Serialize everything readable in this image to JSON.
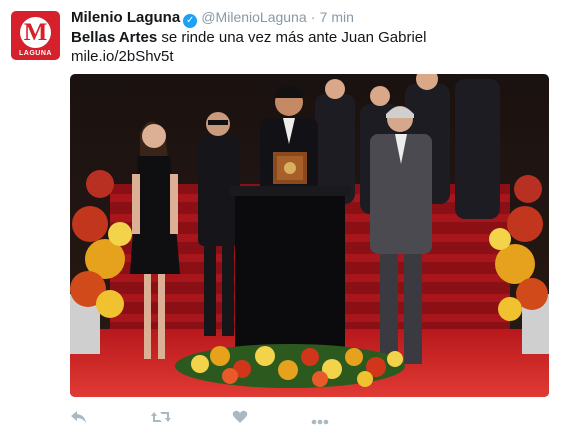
{
  "account": {
    "avatar_text": "M",
    "avatar_label": "LAGUNA",
    "display_name": "Milenio Laguna",
    "handle": "@MilenioLaguna",
    "separator": "·",
    "time": "7 min"
  },
  "tweet": {
    "text_bold": "Bellas Artes",
    "text_rest": " se rinde una vez más ante Juan Gabriel",
    "link": "mile.io/2bShv5t"
  },
  "actions": [
    "reply-icon",
    "retweet-icon",
    "like-icon",
    "more-icon"
  ],
  "colors": {
    "brand": "#d6202b",
    "verified": "#1da1f2",
    "muted": "#8899a6",
    "carpet": "#d42a2a"
  }
}
